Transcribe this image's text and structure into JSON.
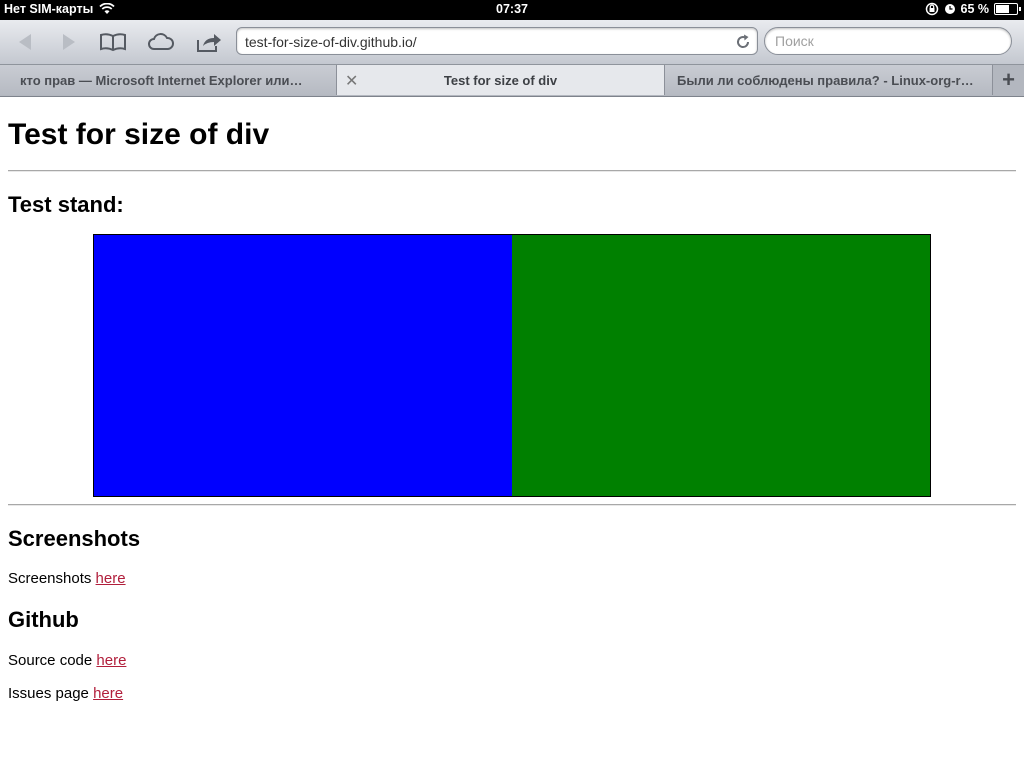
{
  "status_bar": {
    "carrier": "Нет SIM-карты",
    "time": "07:37",
    "battery_percent": "65 %",
    "battery_level": 0.65
  },
  "toolbar": {
    "url": "test-for-size-of-div.github.io/",
    "search_placeholder": "Поиск"
  },
  "tabs": [
    {
      "label": "кто прав — Microsoft Internet Explorer или…",
      "active": false
    },
    {
      "label": "Test for size of div",
      "active": true
    },
    {
      "label": "Были ли соблюдены правила? - Linux-org-r…",
      "active": false
    }
  ],
  "page": {
    "title": "Test for size of div",
    "test_stand_heading": "Test stand:",
    "test_stand_colors": {
      "left": "#0000ff",
      "right": "#008000"
    },
    "screenshots_heading": "Screenshots",
    "screenshots_text": "Screenshots ",
    "screenshots_link": "here",
    "github_heading": "Github",
    "source_text": "Source code ",
    "source_link": "here",
    "issues_text": "Issues page ",
    "issues_link": "here"
  },
  "colors": {
    "link": "#b11e3b"
  }
}
